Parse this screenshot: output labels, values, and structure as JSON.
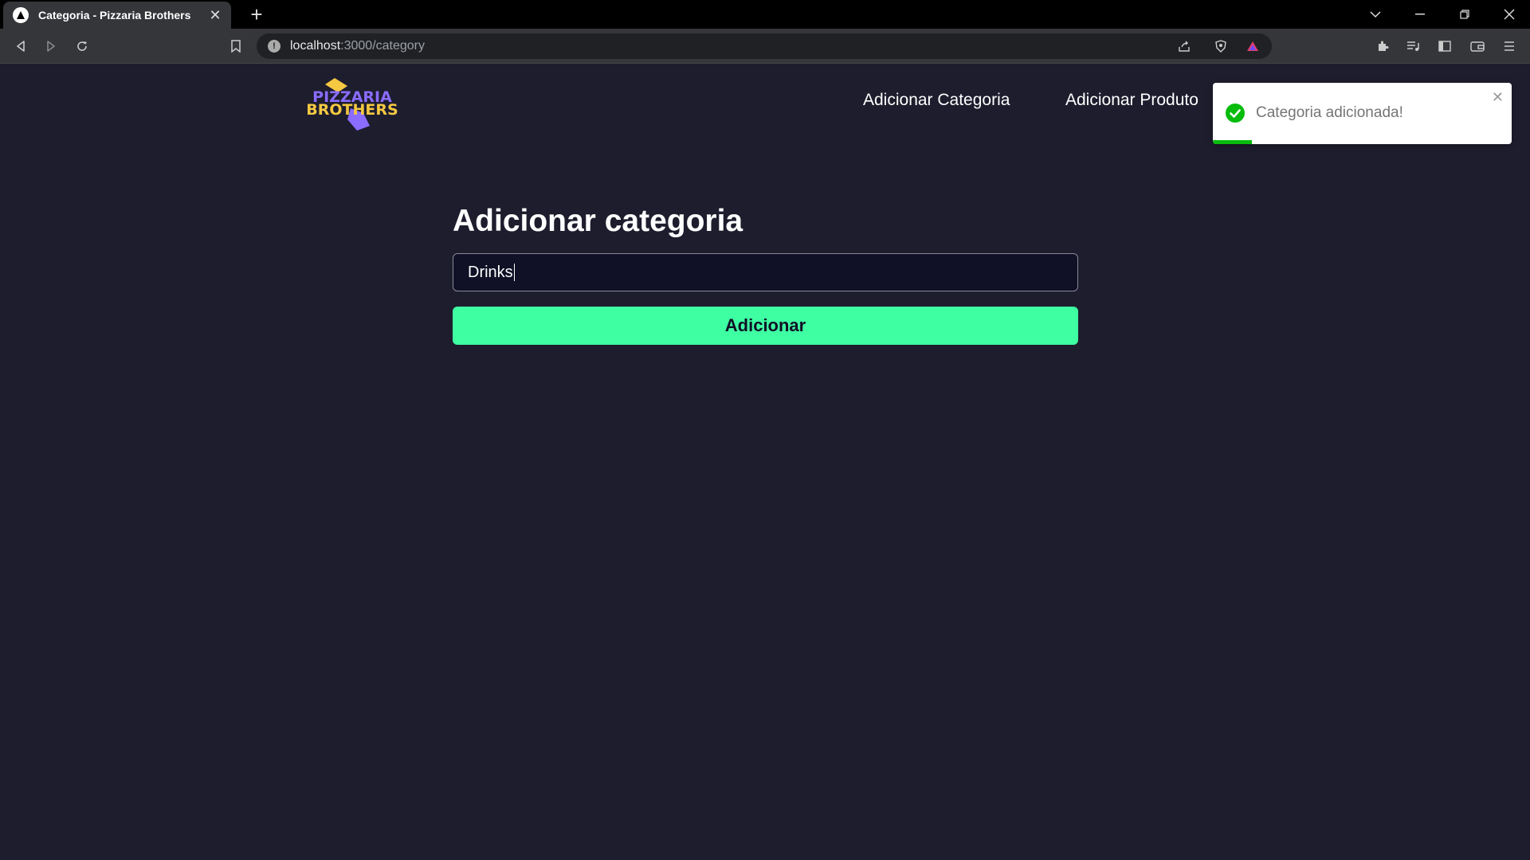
{
  "browser": {
    "tab_title": "Categoria - Pizzaria Brothers",
    "url_host": "localhost",
    "url_path": ":3000/category"
  },
  "header": {
    "logo_text_line1": "PIZZARIA",
    "logo_text_line2": "BROTHERS",
    "nav": [
      {
        "label": "Adicionar Categoria"
      },
      {
        "label": "Adicionar Produto"
      }
    ]
  },
  "form": {
    "title": "Adicionar categoria",
    "input_value": "Drinks",
    "submit_label": "Adicionar"
  },
  "toast": {
    "message": "Categoria adicionada!",
    "progress": 0.13,
    "colors": {
      "success": "#07bc0c"
    }
  },
  "colors": {
    "background": "#1d1d2e",
    "accent": "#3fffa3",
    "input_bg": "#101026"
  }
}
